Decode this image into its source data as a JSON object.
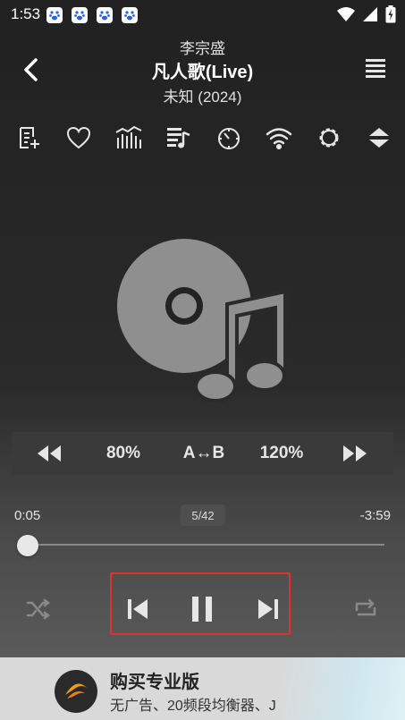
{
  "status_bar": {
    "time": "1:53",
    "notification_icons": [
      "paw-icon",
      "paw-icon",
      "paw-icon",
      "paw-icon"
    ],
    "right_icons": [
      "wifi-icon",
      "signal-icon",
      "battery-icon"
    ]
  },
  "header": {
    "artist": "李宗盛",
    "title": "凡人歌(Live)",
    "album": "未知 (2024)"
  },
  "toolbar": {
    "icons": [
      "add-to-playlist-icon",
      "heart-icon",
      "equalizer-icon",
      "queue-music-icon",
      "timer-icon",
      "wifi-cast-icon",
      "settings-icon",
      "expand-collapse-icon"
    ]
  },
  "speed_bar": {
    "slower_label": "80%",
    "ab_label": "A↔B",
    "faster_label": "120%"
  },
  "progress": {
    "elapsed": "0:05",
    "remaining": "-3:59",
    "track_position": "5/42",
    "fraction": 0.02
  },
  "banner": {
    "title": "购买专业版",
    "subtitle": "无广告、20频段均衡器、J"
  },
  "colors": {
    "highlight_border": "#e03030",
    "icon": "#e6e6e6"
  }
}
